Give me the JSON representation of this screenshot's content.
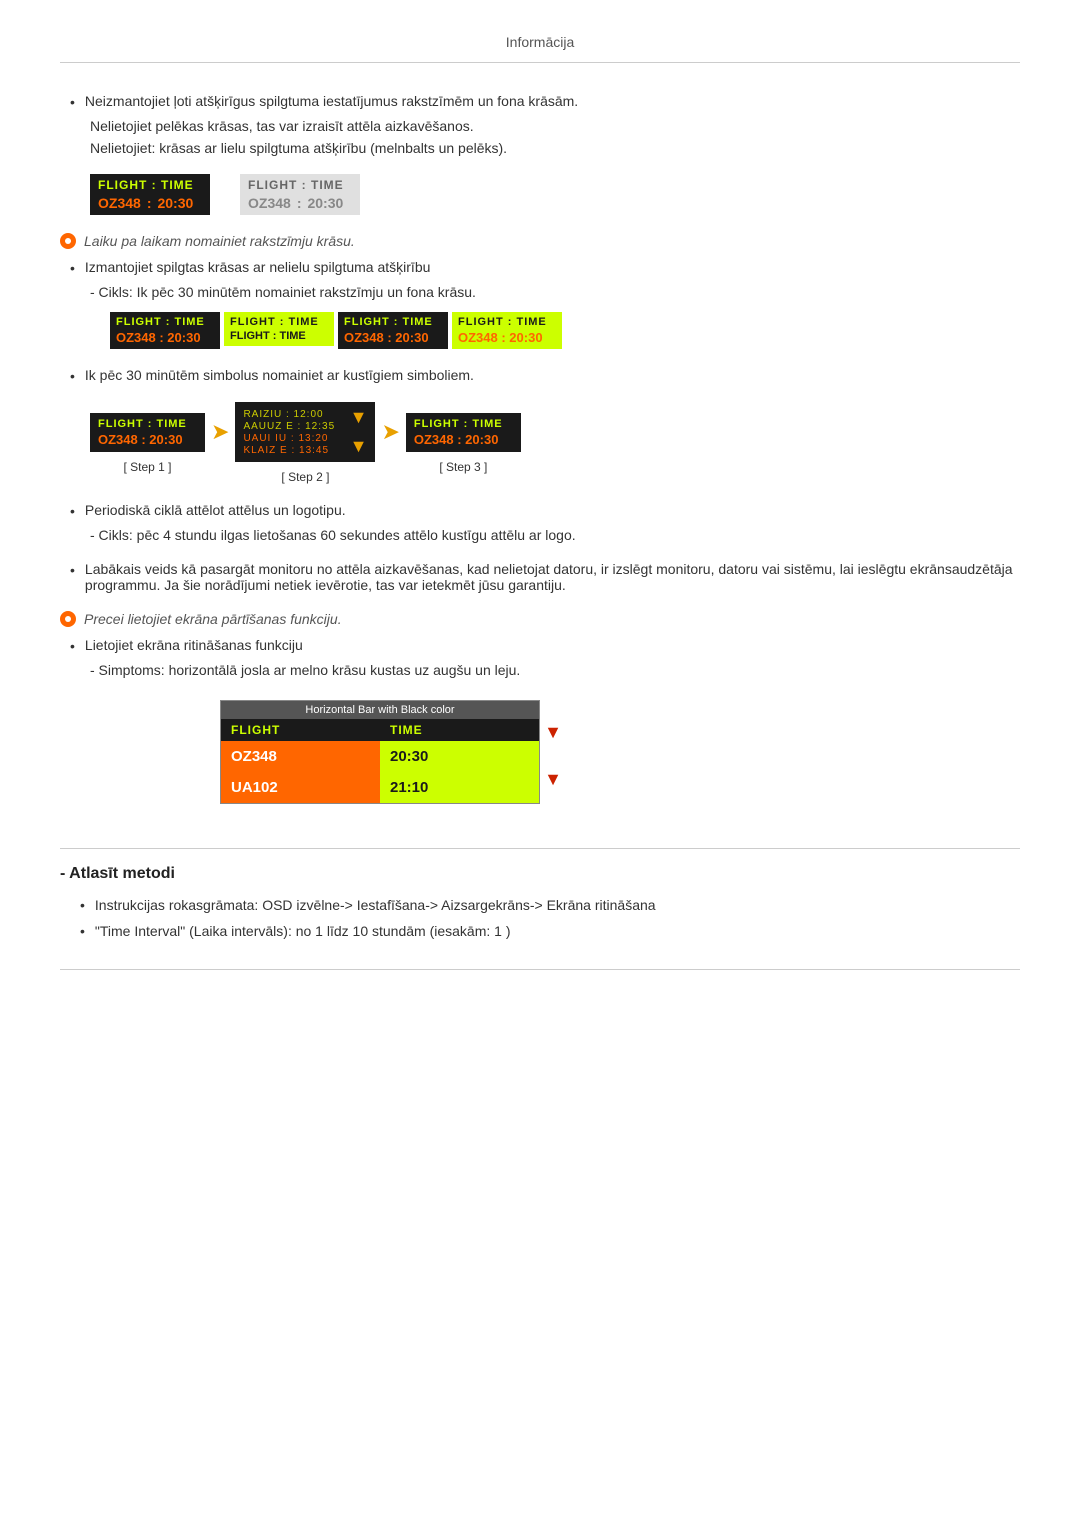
{
  "header": {
    "title": "Informācija"
  },
  "page": {
    "bullet1": {
      "main": "Neizmantojiet ļoti atšķirīgus spilgtuma iestatījumus rakstzīmēm un fona krāsām.",
      "sub1": "Nelietojiet pelēkas krāsas, tas var izraisīt attēla aizkavēšanos.",
      "sub2": "Nelietojiet: krāsas ar lielu spilgtuma atšķirību (melnbalts un pelēks)."
    },
    "flight_box_dark_header": "FLIGHT  :  TIME",
    "flight_box_dark_data1": "OZ348",
    "flight_box_dark_colon": ":",
    "flight_box_dark_data2": "20:30",
    "flight_box_light_header": "FLIGHT  :  TIME",
    "flight_box_light_data1": "OZ348",
    "flight_box_light_colon": ":",
    "flight_box_light_data2": "20:30",
    "italic_note1": "Laiku pa laikam nomainiet rakstzīmju krāsu.",
    "bullet2": "Izmantojiet spilgtas krāsas ar nelielu spilgtuma atšķirību",
    "cikls1": "- Cikls: Ik pēc 30 minūtēm nomainiet rakstzīmju un fona krāsu.",
    "cycling_boxes": [
      {
        "bg": "#1a1a1a",
        "header_color": "#ccff00",
        "data_color": "#ff6600",
        "header": "FLIGHT  :  TIME",
        "data1": "OZ348",
        "data2": "20:30"
      },
      {
        "bg": "#ccff00",
        "header_color": "#1a1a1a",
        "data_color": "#1a1a1a",
        "header": "FLIGHT  :  TIME",
        "data1": "FLIGHT  :  TIME",
        "data2": ""
      },
      {
        "bg": "#1a1a1a",
        "header_color": "#ccff00",
        "data_color": "#ff6600",
        "header": "FLIGHT  :  TIME",
        "data1": "OZ348",
        "data2": "20:30"
      },
      {
        "bg": "#ccff00",
        "header_color": "#1a1a1a",
        "data_color": "#ff6600",
        "header": "FLIGHT  :  TIME",
        "data1": "OZ348",
        "data2": "20:30"
      }
    ],
    "bullet3": "Ik pēc 30 minūtēm simbolus nomainiet ar kustīgiem simboliem.",
    "step1_label": "[ Step 1 ]",
    "step2_label": "[ Step 2 ]",
    "step3_label": "[ Step 3 ]",
    "step1_header": "FLIGHT  :  TIME",
    "step1_data1": "OZ348",
    "step1_data2": "20:30",
    "step2_row1a": "RAIZIU  :  12:00",
    "step2_row1b": "AAUUZ E  :  12:35",
    "step2_row2a": "UAUI IU  :  13:20",
    "step2_row2b": "KLAIZ E  :  13:45",
    "step3_header": "FLIGHT  :  TIME",
    "step3_data1": "OZ348",
    "step3_data2": "20:30",
    "bullet4": "Periodiskā ciklā attēlot attēlus un logotipu.",
    "cikls2": "- Cikls: pēc 4 stundu ilgas lietošanas 60 sekundes attēlo kustīgu attēlu ar logo.",
    "bullet5_main": "Labākais veids kā pasargāt monitoru no attēla aizkavēšanas, kad nelietojat datoru, ir izslēgt monitoru, datoru vai sistēmu, lai ieslēgtu ekrānsaudzētāja programmu. Ja šie norādījumi netiek ievērotie, tas var ietekmēt jūsu garantiju.",
    "italic_note2": "Precei lietojiet ekrāna pārtīšanas funkciju.",
    "bullet6": "Lietojiet ekrāna ritināšanas funkciju",
    "simptoms": "- Simptoms: horizontālā josla ar melno krāsu kustas uz augšu un leju.",
    "hbar_title": "Horizontal Bar with Black color",
    "hbar_header1": "FLIGHT",
    "hbar_header2": "TIME",
    "hbar_row1_col1": "OZ348",
    "hbar_row1_col2": "20:30",
    "hbar_row2_col1": "UA102",
    "hbar_row2_col2": "21:10",
    "atlasit_title": "- Atlasīt metodi",
    "atlasit_bullet1": "Instrukcijas rokasgrāmata: OSD izvēlne-> Iestafīšana-> Aizsargekrāns-> Ekrāna ritināšana",
    "atlasit_bullet2": "\"Time Interval\" (Laika intervāls): no 1 līdz 10 stundām (iesakām: 1 )"
  }
}
